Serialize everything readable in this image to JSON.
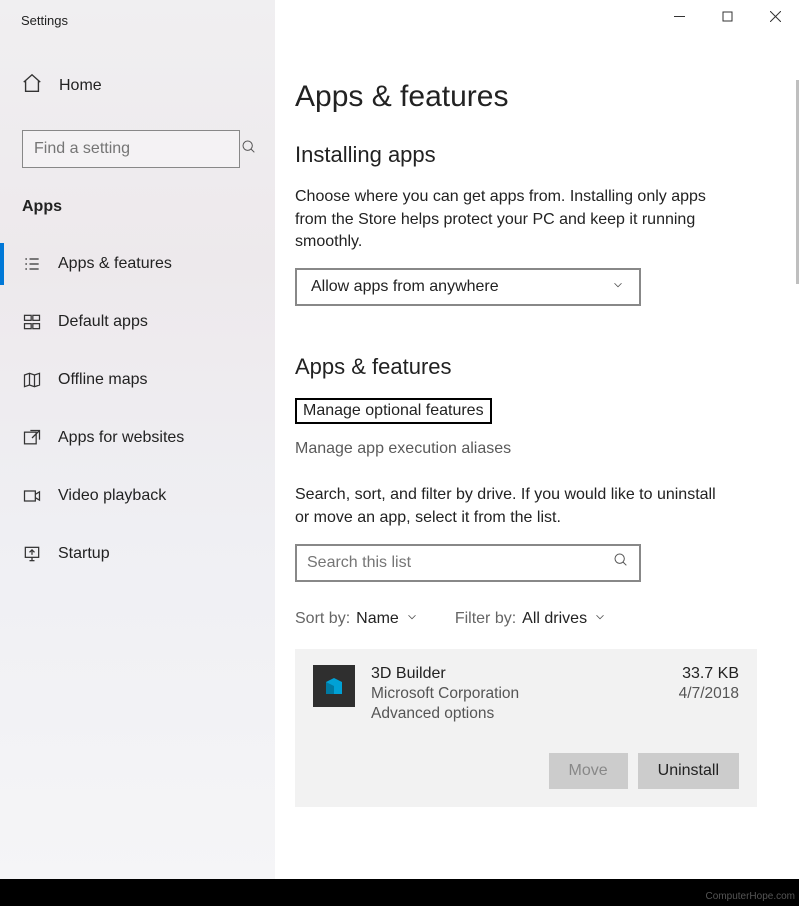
{
  "window_title": "Settings",
  "sidebar": {
    "home": "Home",
    "search_placeholder": "Find a setting",
    "section": "Apps",
    "items": [
      {
        "label": "Apps & features"
      },
      {
        "label": "Default apps"
      },
      {
        "label": "Offline maps"
      },
      {
        "label": "Apps for websites"
      },
      {
        "label": "Video playback"
      },
      {
        "label": "Startup"
      }
    ]
  },
  "main": {
    "h1": "Apps & features",
    "installing_hdr": "Installing apps",
    "installing_text": "Choose where you can get apps from. Installing only apps from the Store helps protect your PC and keep it running smoothly.",
    "install_select": "Allow apps from anywhere",
    "section2_hdr": "Apps & features",
    "optional_link": "Manage optional features",
    "alias_link": "Manage app execution aliases",
    "list_text": "Search, sort, and filter by drive. If you would like to uninstall or move an app, select it from the list.",
    "list_search_placeholder": "Search this list",
    "sort_label": "Sort by:",
    "sort_value": "Name",
    "filter_label": "Filter by:",
    "filter_value": "All drives",
    "app": {
      "name": "3D Builder",
      "publisher": "Microsoft Corporation",
      "advanced": "Advanced options",
      "size": "33.7 KB",
      "date": "4/7/2018",
      "move_btn": "Move",
      "uninstall_btn": "Uninstall"
    }
  },
  "attribution": "ComputerHope.com"
}
